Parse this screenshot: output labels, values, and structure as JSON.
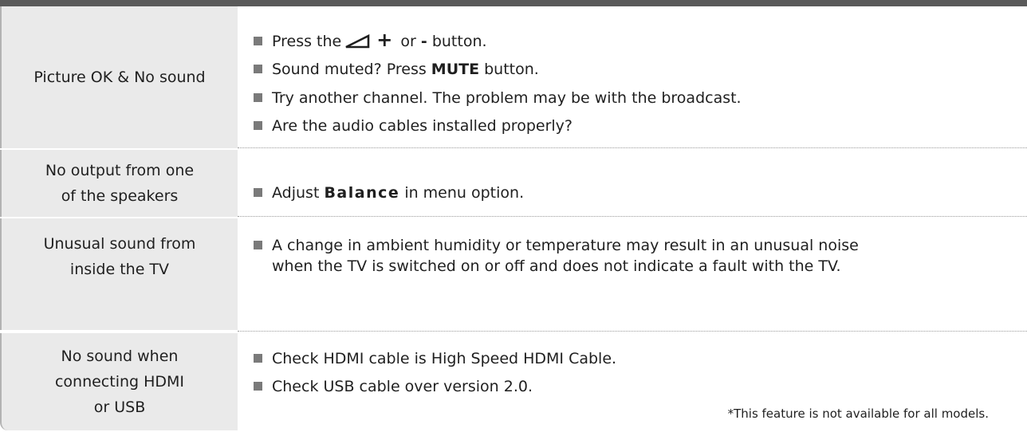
{
  "rows": [
    {
      "label": "Picture OK & No sound",
      "items": [
        {
          "before": "Press the",
          "after_plus": "or",
          "minus": "-",
          "end": "button."
        },
        {
          "before": "Sound muted? Press",
          "bold": "MUTE",
          "after": "button."
        },
        {
          "text": "Try another channel. The problem may be with the broadcast."
        },
        {
          "text": "Are the audio cables installed properly?"
        }
      ]
    },
    {
      "label_line1": "No output from one",
      "label_line2": "of the speakers",
      "items": [
        {
          "before": "Adjust",
          "bold": "Balance",
          "after": "in menu option."
        }
      ]
    },
    {
      "label_line1": "Unusual sound from",
      "label_line2": "inside the TV",
      "items": [
        {
          "line1": "A change in ambient humidity or temperature may result in an unusual noise",
          "line2": "when the TV is switched on or off and does not indicate a fault with the TV."
        }
      ]
    },
    {
      "label_line1": "No sound when",
      "label_line2": "connecting HDMI",
      "label_line3": "or USB",
      "items": [
        {
          "text": "Check HDMI cable is High Speed HDMI Cable."
        },
        {
          "text": "Check USB cable over version 2.0."
        }
      ],
      "footnote": "*This feature is not available for all models."
    }
  ],
  "icons": {
    "volume": "volume-icon",
    "plus": "+",
    "bullet": "square-bullet"
  },
  "colors": {
    "top_bar": "#5a5a5a",
    "label_bg": "#eaeaea",
    "bullet": "#7a7a7a",
    "divider": "#9a9a9a"
  }
}
